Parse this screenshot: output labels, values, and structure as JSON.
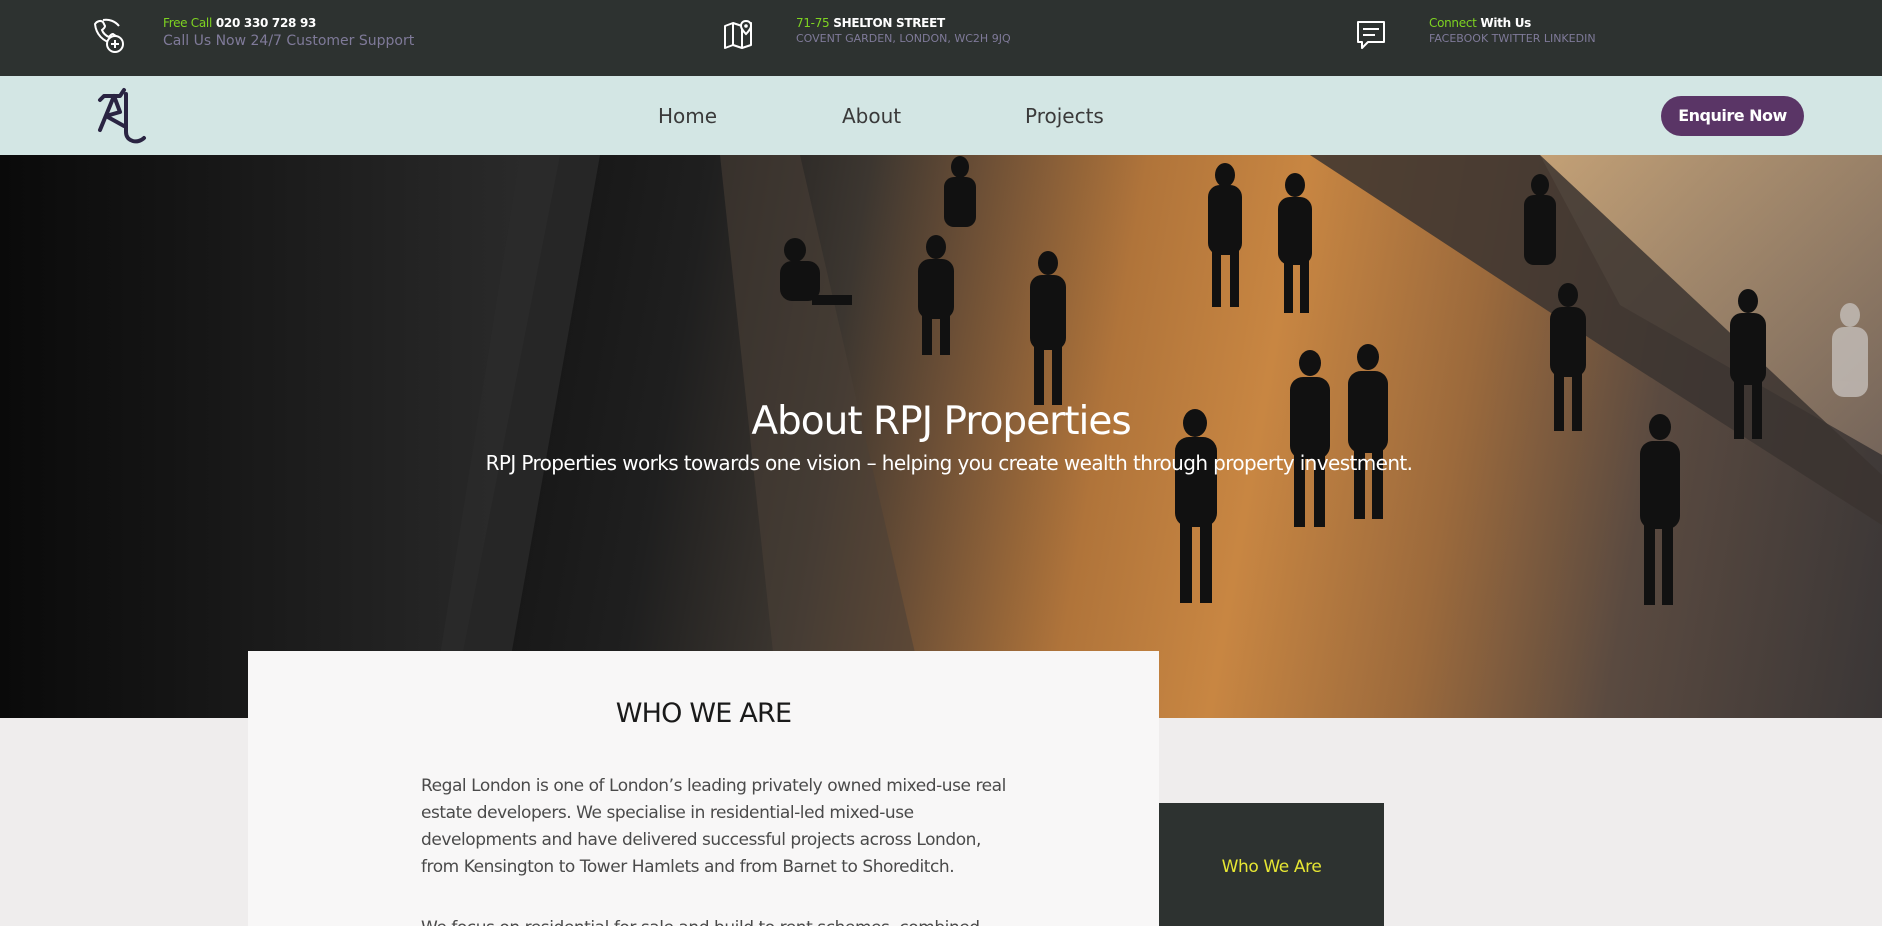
{
  "topbar": {
    "phone": {
      "accent": "Free Call",
      "number": "020 330 728 93",
      "subline": "Call Us Now 24/7 Customer Support",
      "icon": "phone-icon"
    },
    "address": {
      "accent": "71-75",
      "street": "SHELTON STREET",
      "subline": "COVENT GARDEN, LONDON, WC2H 9JQ",
      "icon": "map-icon"
    },
    "connect": {
      "accent": "Connect",
      "title": "With Us",
      "subline": "FACEBOOK TWITTER LINKEDIN",
      "icon": "chat-icon"
    }
  },
  "nav": {
    "logo": "rpj-logo",
    "items": [
      "Home",
      "About",
      "Projects"
    ],
    "cta": "Enquire Now"
  },
  "hero": {
    "title": "About RPJ Properties",
    "subtitle": "RPJ Properties works towards one vision – helping you create wealth through property investment."
  },
  "content": {
    "heading": "WHO WE ARE",
    "paragraph1": "Regal London is one of London’s leading privately owned mixed-use real estate developers. We specialise in residential-led mixed-use developments and have delivered successful projects across London, from Kensington to Tower Hamlets and from Barnet to Shoreditch.",
    "paragraph2": "We focus on residential for sale and build to rent schemes, combined"
  },
  "sidebar": {
    "link": "Who We Are"
  },
  "colors": {
    "topbar_bg": "#2d3230",
    "navbar_bg": "#d3e6e4",
    "accent_green": "#7ed321",
    "accent_purple": "#5a3566",
    "subtext_purple": "#7f7a99",
    "link_yellow": "#e6e633"
  }
}
